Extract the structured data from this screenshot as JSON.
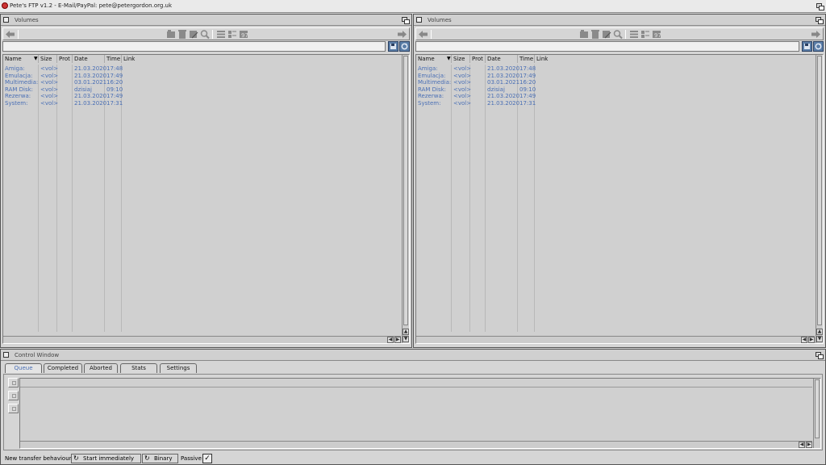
{
  "screen": {
    "title": "Pete's FTP v1.2 - E-Mail/PayPal: pete@petergordon.org.uk"
  },
  "left_pane": {
    "title": "Volumes",
    "path_value": "",
    "columns": [
      "Name",
      "Size",
      "Prot",
      "Date",
      "Time",
      "Link"
    ],
    "rows": [
      {
        "name": "Amiga:",
        "size": "<vol>",
        "prot": "",
        "date": "21.03.2020",
        "time": "17:48",
        "link": ""
      },
      {
        "name": "Emulacja:",
        "size": "<vol>",
        "prot": "",
        "date": "21.03.2020",
        "time": "17:49",
        "link": ""
      },
      {
        "name": "Multimedia:",
        "size": "<vol>",
        "prot": "",
        "date": "03.01.2021",
        "time": "16:20",
        "link": ""
      },
      {
        "name": "RAM Disk:",
        "size": "<vol>",
        "prot": "",
        "date": "dzisiaj",
        "time": "09:10",
        "link": ""
      },
      {
        "name": "Rezerwa:",
        "size": "<vol>",
        "prot": "",
        "date": "21.03.2020",
        "time": "17:49",
        "link": ""
      },
      {
        "name": "System:",
        "size": "<vol>",
        "prot": "",
        "date": "21.03.2020",
        "time": "17:31",
        "link": ""
      }
    ]
  },
  "right_pane": {
    "title": "Volumes",
    "path_value": "",
    "columns": [
      "Name",
      "Size",
      "Prot",
      "Date",
      "Time",
      "Link"
    ],
    "rows": [
      {
        "name": "Amiga:",
        "size": "<vol>",
        "prot": "",
        "date": "21.03.2020",
        "time": "17:48",
        "link": ""
      },
      {
        "name": "Emulacja:",
        "size": "<vol>",
        "prot": "",
        "date": "21.03.2020",
        "time": "17:49",
        "link": ""
      },
      {
        "name": "Multimedia:",
        "size": "<vol>",
        "prot": "",
        "date": "03.01.2021",
        "time": "16:20",
        "link": ""
      },
      {
        "name": "RAM Disk:",
        "size": "<vol>",
        "prot": "",
        "date": "dzisiaj",
        "time": "09:10",
        "link": ""
      },
      {
        "name": "Rezerwa:",
        "size": "<vol>",
        "prot": "",
        "date": "21.03.2020",
        "time": "17:49",
        "link": ""
      },
      {
        "name": "System:",
        "size": "<vol>",
        "prot": "",
        "date": "21.03.2020",
        "time": "17:31",
        "link": ""
      }
    ]
  },
  "control": {
    "title": "Control Window",
    "tabs": [
      "Queue",
      "Completed",
      "Aborted",
      "Stats",
      "Settings"
    ],
    "active_tab": "Queue",
    "transfer_label": "New transfer behaviour",
    "start_mode": "Start immediately",
    "transfer_mode": "Binary",
    "passive_label": "Passive",
    "passive_checked": "✓"
  },
  "colors": {
    "accent": "#4a6fb5",
    "background": "#d5d5d5",
    "toolbar_button_blue": "#5b7ea8"
  },
  "icons": {
    "toolbar": [
      "back-arrow-icon",
      "makedir-icon",
      "delete-icon",
      "rename-icon",
      "search-icon",
      "list-view-icon",
      "detail-view-icon",
      "sort-icon",
      "forward-arrow-icon"
    ],
    "path": [
      "disk-icon",
      "refresh-icon"
    ]
  }
}
